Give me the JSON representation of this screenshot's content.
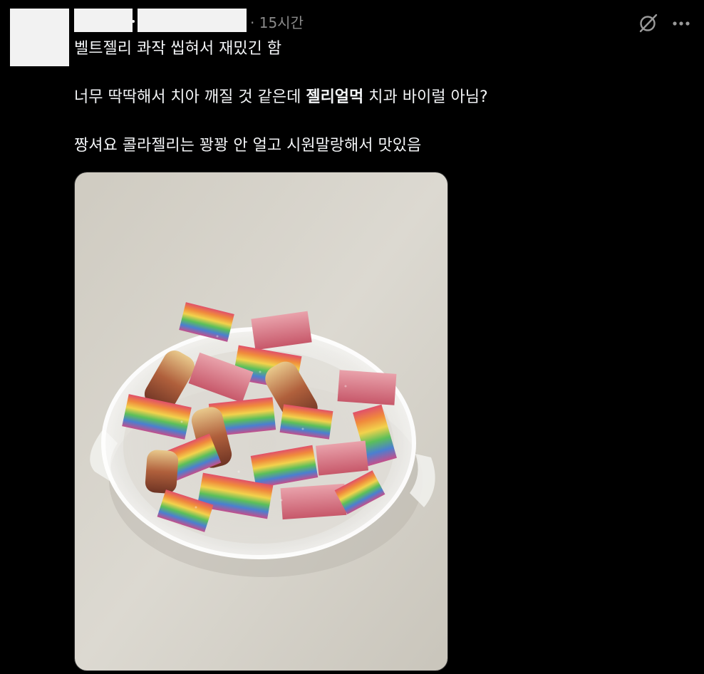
{
  "post": {
    "timestamp": "· 15시간",
    "line1": "벨트젤리 콰작 씹혀서 재밌긴 함",
    "line2_pre": "너무 딱딱해서 치아 깨질 것 같은데 ",
    "line2_bold": "젤리얼먹",
    "line2_post": " 치과 바이럴 아님?",
    "line3": "짱셔요 콜라젤리는 꽝꽝 안 얼고 시원말랑해서 맛있음"
  },
  "icons": {
    "no_repost": "no-repost-icon",
    "more": "more-options-icon"
  },
  "colors": {
    "background": "#000000",
    "text": "#f3f5f7",
    "muted": "#8a8a8a",
    "redacted": "#f2f2f2"
  }
}
